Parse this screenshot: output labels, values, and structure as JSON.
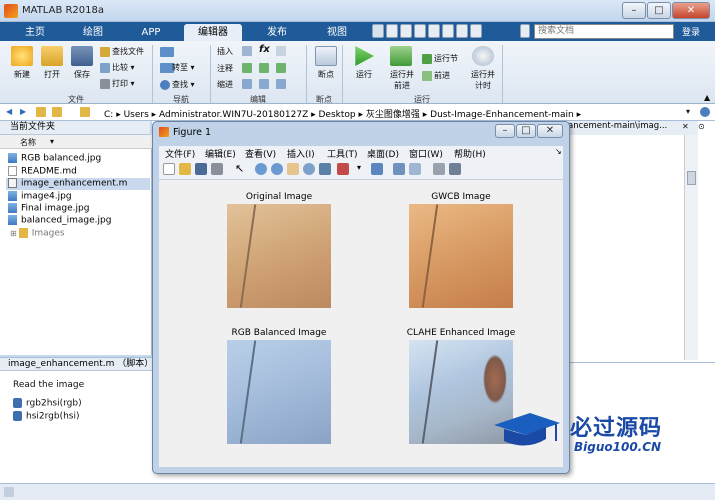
{
  "app": {
    "title": "MATLAB R2018a"
  },
  "ribbon": {
    "tabs": [
      "主页",
      "绘图",
      "APP",
      "编辑器",
      "发布",
      "视图"
    ],
    "active_tab": "编辑器",
    "search_placeholder": "搜索文档",
    "login": "登录",
    "groups": {
      "file": {
        "label": "文件",
        "new": "新建",
        "open": "打开",
        "save": "保存",
        "find_files": "查找文件",
        "compare": "比较",
        "print": "打印"
      },
      "nav": {
        "label": "导航",
        "goto": "转至",
        "find": "查找"
      },
      "edit": {
        "label": "编辑",
        "insert": "插入",
        "comment": "注释",
        "indent": "缩进",
        "fx": "fx"
      },
      "breakpoint": {
        "label": "断点",
        "breakpoints": "断点"
      },
      "run": {
        "label": "运行",
        "run": "运行",
        "run_advance": "运行并\n前进",
        "run_section": "运行节",
        "advance": "前进",
        "run_time": "运行并\n计时"
      }
    }
  },
  "address": {
    "segments": [
      "C:",
      "Users",
      "Administrator.WIN7U-20180127Z",
      "Desktop",
      "灰尘图像增强",
      "Dust-Image-Enhancement-main"
    ]
  },
  "folder": {
    "header": "当前文件夹",
    "column": "名称",
    "files": [
      {
        "name": "RGB balanced.jpg",
        "type": "image"
      },
      {
        "name": "README.md",
        "type": "doc"
      },
      {
        "name": "image_enhancement.m",
        "type": "script",
        "selected": true
      },
      {
        "name": "image4.jpg",
        "type": "image"
      },
      {
        "name": "Final image.jpg",
        "type": "image"
      },
      {
        "name": "balanced_image.jpg",
        "type": "image"
      },
      {
        "name": "Images",
        "type": "folder"
      }
    ]
  },
  "details": {
    "header": "image_enhancement.m （脚本）",
    "description": "Read the image",
    "functions": [
      "rgb2hsi(rgb)",
      "hsi2rgb(hsi)"
    ]
  },
  "editor": {
    "tab_path": "ancement-main\\imag..."
  },
  "figure": {
    "title": "Figure 1",
    "menu": [
      "文件(F)",
      "编辑(E)",
      "查看(V)",
      "插入(I)",
      "工具(T)",
      "桌面(D)",
      "窗口(W)",
      "帮助(H)"
    ],
    "subplots": [
      {
        "title": "Original Image"
      },
      {
        "title": "GWCB Image"
      },
      {
        "title": "RGB Balanced Image"
      },
      {
        "title": "CLAHE Enhanced Image"
      }
    ]
  },
  "watermark": {
    "text": "必过源码",
    "url": "Biguo100.CN"
  }
}
